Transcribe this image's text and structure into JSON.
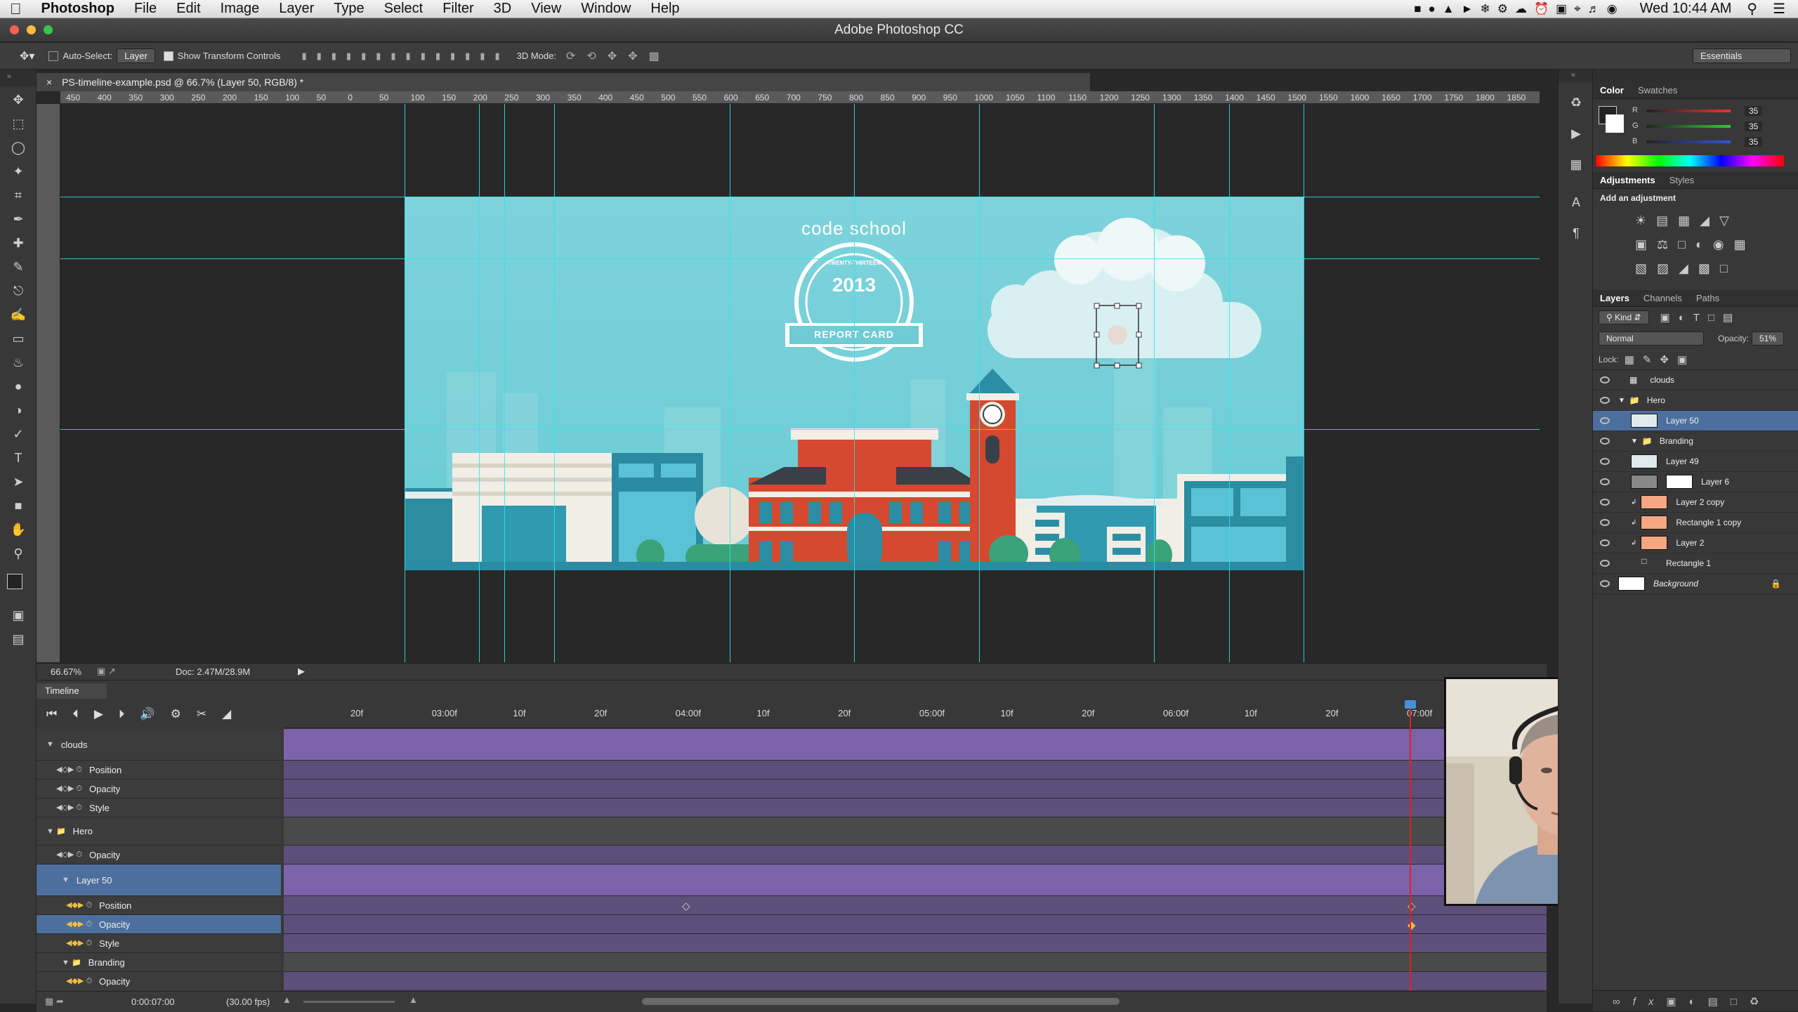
{
  "menubar": {
    "apple": "",
    "app": "Photoshop",
    "items": [
      "File",
      "Edit",
      "Image",
      "Layer",
      "Type",
      "Select",
      "Filter",
      "3D",
      "View",
      "Window",
      "Help"
    ],
    "clock": "Wed 10:44 AM"
  },
  "window": {
    "title": "Adobe Photoshop CC"
  },
  "options": {
    "auto_select": "Auto-Select:",
    "auto_select_value": "Layer",
    "transform": "Show Transform Controls",
    "mode3d": "3D Mode:",
    "workspace": "Essentials"
  },
  "document": {
    "tab": "PS-timeline-example.psd @ 66.7% (Layer 50, RGB/8) *",
    "zoom": "66.67%",
    "docsize": "Doc: 2.47M/28.9M",
    "ruler": [
      "450",
      "400",
      "350",
      "300",
      "250",
      "200",
      "150",
      "100",
      "50",
      "0",
      "50",
      "100",
      "150",
      "200",
      "250",
      "300",
      "350",
      "400",
      "450",
      "500",
      "550",
      "600",
      "650",
      "700",
      "750",
      "800",
      "850",
      "900",
      "950",
      "1000",
      "1050",
      "1100",
      "1150",
      "1200",
      "1250",
      "1300",
      "1350",
      "1400",
      "1450",
      "1500",
      "1550",
      "1600",
      "1650",
      "1700",
      "1750",
      "1800",
      "1850"
    ],
    "art": {
      "brand": "code school",
      "badge_top": "TWENTY-THIRTEEN",
      "year": "2013",
      "ribbon": "REPORT CARD"
    }
  },
  "timeline": {
    "title": "Timeline",
    "ruler": [
      "20f",
      "03:00f",
      "10f",
      "20f",
      "04:00f",
      "10f",
      "20f",
      "05:00f",
      "10f",
      "20f",
      "06:00f",
      "10f",
      "20f",
      "07:00f"
    ],
    "tracks": [
      {
        "label": "clouds",
        "type": "group"
      },
      {
        "label": "Position",
        "type": "prop"
      },
      {
        "label": "Opacity",
        "type": "prop"
      },
      {
        "label": "Style",
        "type": "prop"
      },
      {
        "label": "Hero",
        "type": "folder"
      },
      {
        "label": "Opacity",
        "type": "prop"
      },
      {
        "label": "Layer 50",
        "type": "layer"
      },
      {
        "label": "Position",
        "type": "prop2"
      },
      {
        "label": "Opacity",
        "type": "prop2sel"
      },
      {
        "label": "Style",
        "type": "prop2"
      },
      {
        "label": "Branding",
        "type": "folder2"
      },
      {
        "label": "Opacity",
        "type": "prop2"
      }
    ],
    "time": "0:00:07:00",
    "fps": "(30.00 fps)"
  },
  "panels": {
    "color_tabs": [
      "Color",
      "Swatches"
    ],
    "rgb": [
      {
        "ch": "R",
        "val": "35"
      },
      {
        "ch": "G",
        "val": "35"
      },
      {
        "ch": "B",
        "val": "35"
      }
    ],
    "adj_tabs": [
      "Adjustments",
      "Styles"
    ],
    "add_adjustment": "Add an adjustment",
    "layer_tabs": [
      "Layers",
      "Channels",
      "Paths"
    ],
    "kind": "Kind",
    "blend": "Normal",
    "opacity_label": "Opacity:",
    "opacity_value": "51%",
    "lock": "Lock:",
    "layers": [
      {
        "name": "clouds",
        "indent": 0,
        "kind": "group",
        "selected": false
      },
      {
        "name": "Hero",
        "indent": 0,
        "kind": "folder",
        "selected": false
      },
      {
        "name": "Layer 50",
        "indent": 1,
        "kind": "layer",
        "selected": true
      },
      {
        "name": "Branding",
        "indent": 1,
        "kind": "folder",
        "selected": false
      },
      {
        "name": "Layer 49",
        "indent": 1,
        "kind": "layer",
        "selected": false
      },
      {
        "name": "Layer 6",
        "indent": 1,
        "kind": "mask",
        "selected": false
      },
      {
        "name": "Layer 2 copy",
        "indent": 1,
        "kind": "clip",
        "selected": false
      },
      {
        "name": "Rectangle 1 copy",
        "indent": 1,
        "kind": "clip",
        "selected": false
      },
      {
        "name": "Layer 2",
        "indent": 1,
        "kind": "clip",
        "selected": false
      },
      {
        "name": "Rectangle 1",
        "indent": 1,
        "kind": "shape",
        "selected": false
      },
      {
        "name": "Background",
        "indent": 0,
        "kind": "bg",
        "selected": false
      }
    ]
  },
  "colors": {
    "guide": "#2ee6f0",
    "lane": "#7b63a9",
    "playhead": "#e02020",
    "selection": "#4d6f9e"
  }
}
